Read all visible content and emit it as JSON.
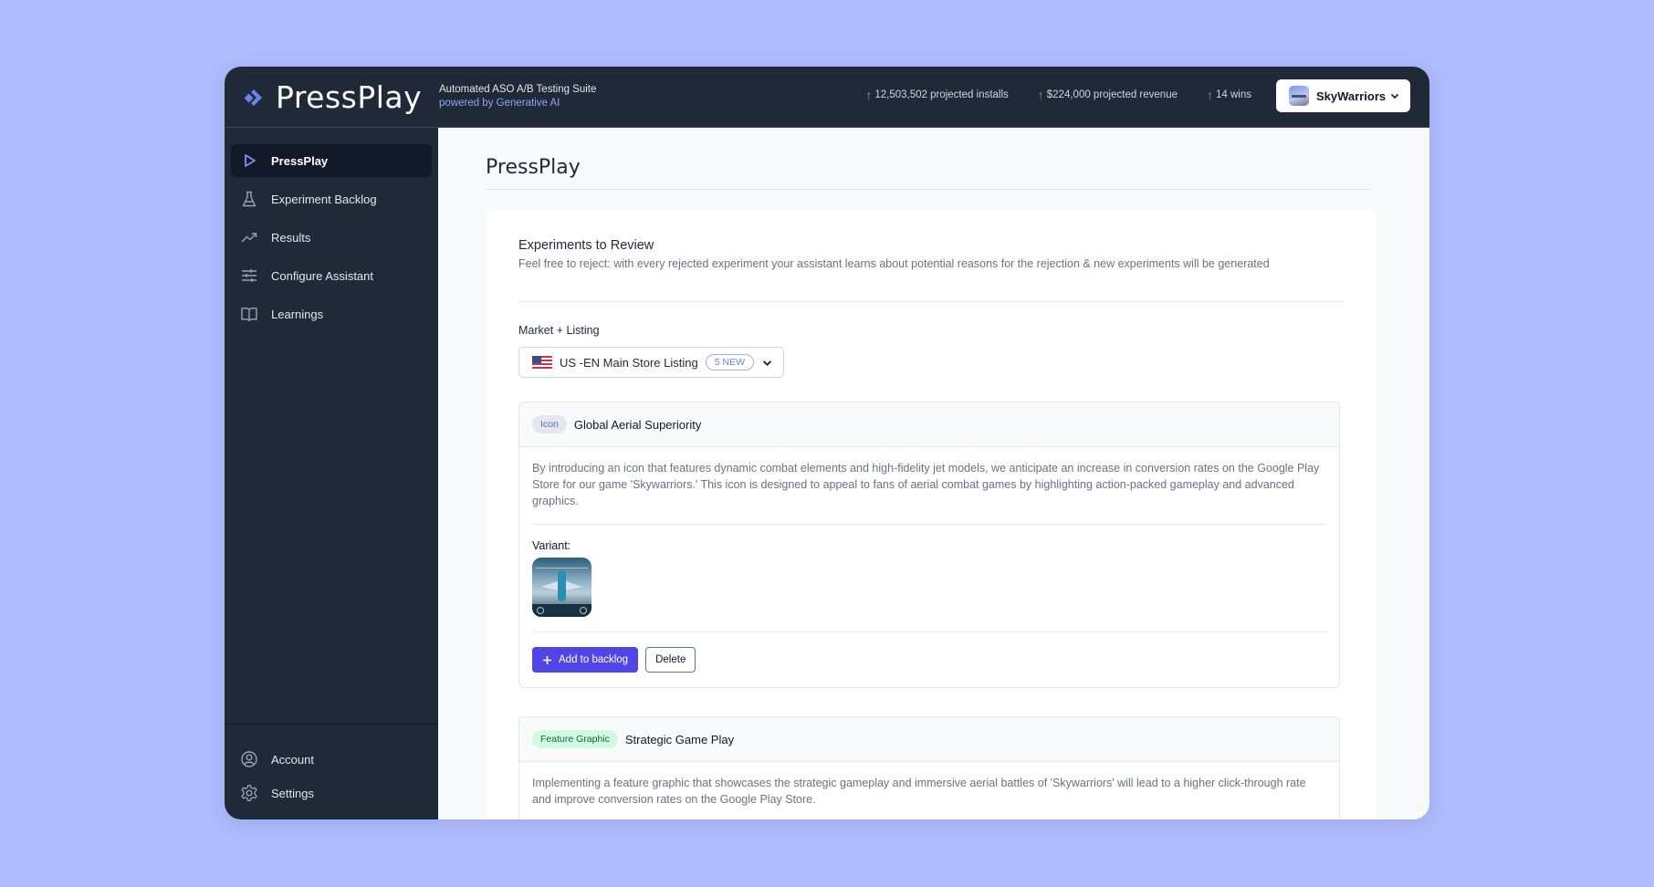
{
  "header": {
    "app_name": "PressPlay",
    "tagline": "Automated ASO A/B Testing Suite",
    "tagline_sub": "powered by Generative AI",
    "stats": [
      {
        "icon": "arrow-up-icon",
        "label": "12,503,502 projected installs"
      },
      {
        "icon": "arrow-up-icon",
        "label": "$224,000 projected revenue"
      },
      {
        "icon": "arrow-up-icon",
        "label": "14 wins"
      }
    ],
    "app_selector": {
      "name": "SkyWarriors",
      "icon": "app-thumbnail"
    }
  },
  "sidebar": {
    "items": [
      {
        "label": "PressPlay",
        "icon": "play-icon",
        "active": true
      },
      {
        "label": "Experiment Backlog",
        "icon": "flask-icon",
        "active": false
      },
      {
        "label": "Results",
        "icon": "trending-up-icon",
        "active": false
      },
      {
        "label": "Configure Assistant",
        "icon": "sliders-icon",
        "active": false
      },
      {
        "label": "Learnings",
        "icon": "book-icon",
        "active": false
      }
    ],
    "bottom_items": [
      {
        "label": "Account",
        "icon": "user-circle-icon"
      },
      {
        "label": "Settings",
        "icon": "gear-icon"
      }
    ]
  },
  "main": {
    "page_title": "PressPlay",
    "section_title": "Experiments to Review",
    "section_subtitle": "Feel free to reject: with every rejected experiment your assistant learns about potential reasons for the rejection & new experiments will be generated",
    "market_label": "Market + Listing",
    "market_select": {
      "value": "US -EN Main Store Listing",
      "badge": "5 NEW",
      "flag": "us-flag"
    },
    "experiments": [
      {
        "tag": "Icon",
        "title": "Global Aerial Superiority",
        "description": "By introducing an icon that features dynamic combat elements and high-fidelity jet models, we anticipate an increase in conversion rates on the Google Play Store for our game 'Skywarriors.' This icon is designed to appeal to fans of aerial combat games by highlighting action-packed gameplay and advanced graphics.",
        "variant_label": "Variant:",
        "add_label": "Add to backlog",
        "delete_label": "Delete"
      },
      {
        "tag": "Feature Graphic",
        "title": "Strategic Game Play",
        "description": "Implementing a feature graphic that showcases the strategic gameplay and immersive aerial battles of 'Skywarriors' will lead to a higher click-through rate and improve conversion rates on the Google Play Store."
      }
    ]
  },
  "colors": {
    "background": "#aebbfc",
    "dark": "#1f2937",
    "accent": "#4f46e5",
    "accent_light": "#7b93f2"
  }
}
